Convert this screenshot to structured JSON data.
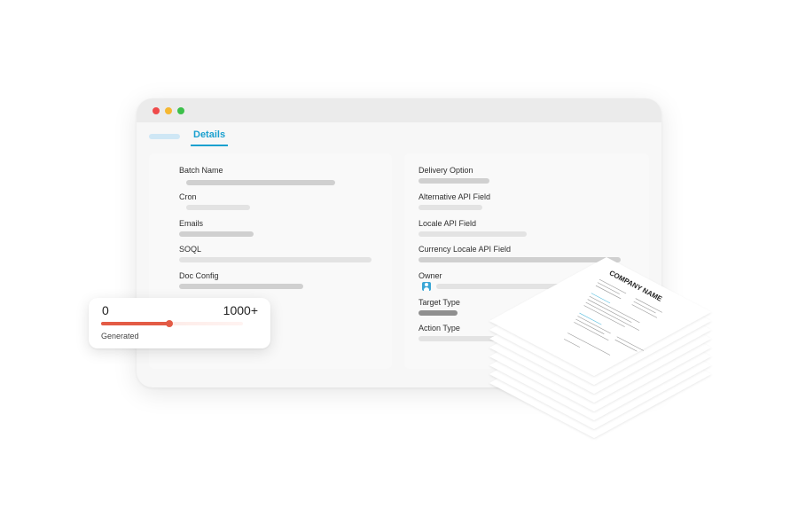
{
  "window": {
    "tabs": [
      {
        "label": ""
      },
      {
        "label": "Details"
      }
    ]
  },
  "left_fields": [
    {
      "label": "Batch Name"
    },
    {
      "label": "Cron"
    },
    {
      "label": "Emails"
    },
    {
      "label": "SOQL"
    },
    {
      "label": "Doc Config"
    }
  ],
  "right_fields": [
    {
      "label": "Delivery Option"
    },
    {
      "label": "Alternative API Field"
    },
    {
      "label": "Locale API Field"
    },
    {
      "label": "Currency Locale API Field"
    },
    {
      "label": "Owner"
    },
    {
      "label": "Target Type"
    },
    {
      "label": "Action Type"
    }
  ],
  "generated": {
    "min": "0",
    "max": "1000+",
    "label": "Generated",
    "progress": 0.48,
    "accent_color": "#e35b45"
  },
  "document": {
    "company_name": "COMPANY NAME"
  },
  "colors": {
    "accent": "#1aa0cf",
    "close": "#ef4a4a",
    "minimize": "#f5b731",
    "maximize": "#3cc04a"
  }
}
